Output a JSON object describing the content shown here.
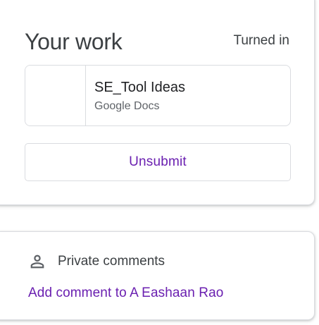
{
  "work": {
    "title": "Your work",
    "status": "Turned in",
    "attachment": {
      "name": "SE_Tool Ideas",
      "type": "Google Docs"
    },
    "unsubmit_label": "Unsubmit"
  },
  "comments": {
    "icon": "person-icon",
    "title": "Private comments",
    "add_label": "Add comment to A Eashaan Rao"
  },
  "colors": {
    "accent": "#6a1fb0",
    "text": "#3c4043",
    "border": "#dadce0"
  }
}
